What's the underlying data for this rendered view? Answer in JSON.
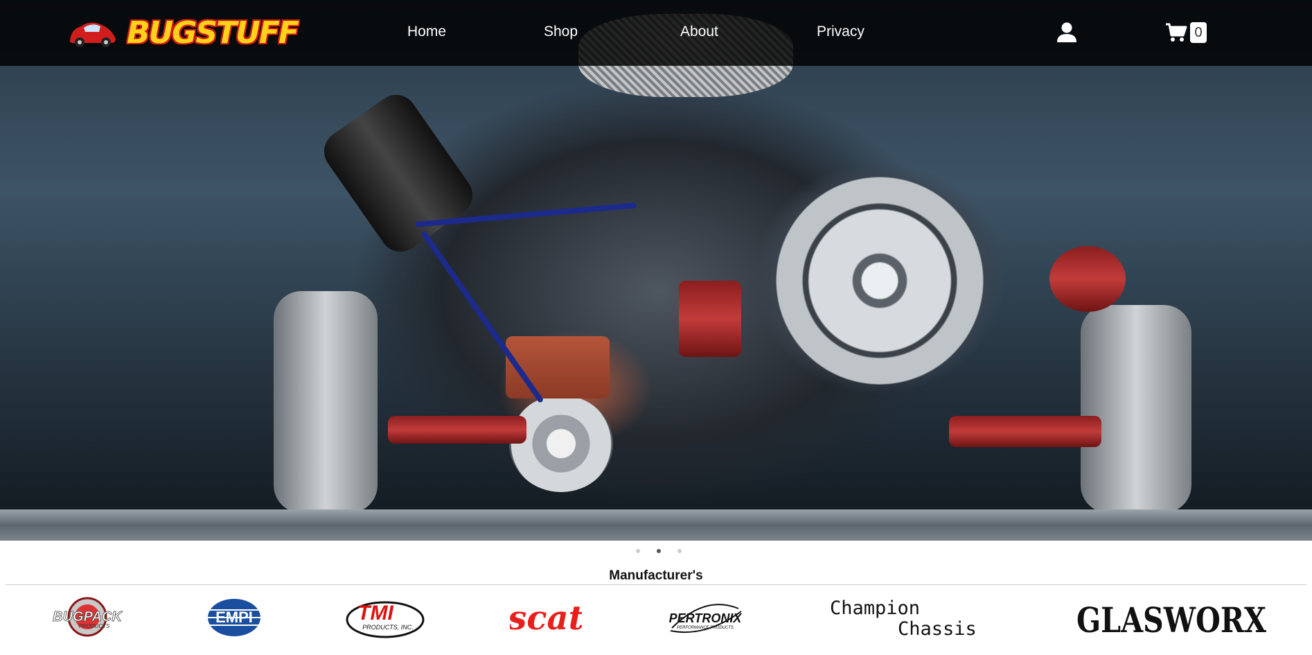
{
  "nav": {
    "logo_text": "BUGSTUFF",
    "items": [
      {
        "label": "Home"
      },
      {
        "label": "Shop"
      },
      {
        "label": "About"
      },
      {
        "label": "Privacy"
      }
    ],
    "user_icon": "user-icon",
    "cart_icon": "shopping-cart-icon",
    "cart_count": "0"
  },
  "carousel": {
    "slide_count": 3,
    "active_slide": 2
  },
  "manufacturers": {
    "title": "Manufacturer's",
    "brands": [
      {
        "name": "BUGPACK",
        "sub": "PRODUCTS"
      },
      {
        "name": "EMPI"
      },
      {
        "name": "TMI",
        "sub": "PRODUCTS, INC."
      },
      {
        "name": "scat"
      },
      {
        "name": "PERTRONIX",
        "sub": "PERFORMANCE PRODUCTS"
      },
      {
        "name": "Champion",
        "name2": "Chassis"
      },
      {
        "name": "GLASWORX"
      }
    ]
  },
  "colors": {
    "nav_bg": "#000000",
    "logo_yellow": "#ffd21a",
    "logo_red": "#d01a1a"
  }
}
